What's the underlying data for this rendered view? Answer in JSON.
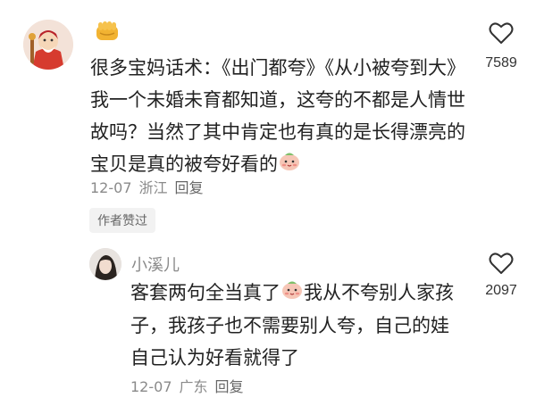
{
  "comment": {
    "badge_icon": "fist-emoji",
    "text_before_emoji": "很多宝妈话术：《出门都夸》《从小被夸到大》我一个未婚未育都知道，这夸的不都是人情世故吗？当然了其中肯定也有真的是长得漂亮的宝贝是真的被夸好看的",
    "emoji": "blush-face-emoji",
    "date": "12-07",
    "location": "浙江",
    "reply_label": "回复",
    "like_count": "7589",
    "author_tag": "作者赞过"
  },
  "reply": {
    "username": "小溪儿",
    "text_before_emoji": "客套两句全当真了",
    "emoji": "blush-face-emoji",
    "text_after_emoji": "我从不夸别人家孩子，我孩子也不需要别人夸，自己的娃自己认为好看就得了",
    "date": "12-07",
    "location": "广东",
    "reply_label": "回复",
    "like_count": "2097"
  },
  "colors": {
    "meta": "#8a8a8a",
    "username": "#8a8a8a",
    "tag_bg": "#f2f2f2"
  }
}
